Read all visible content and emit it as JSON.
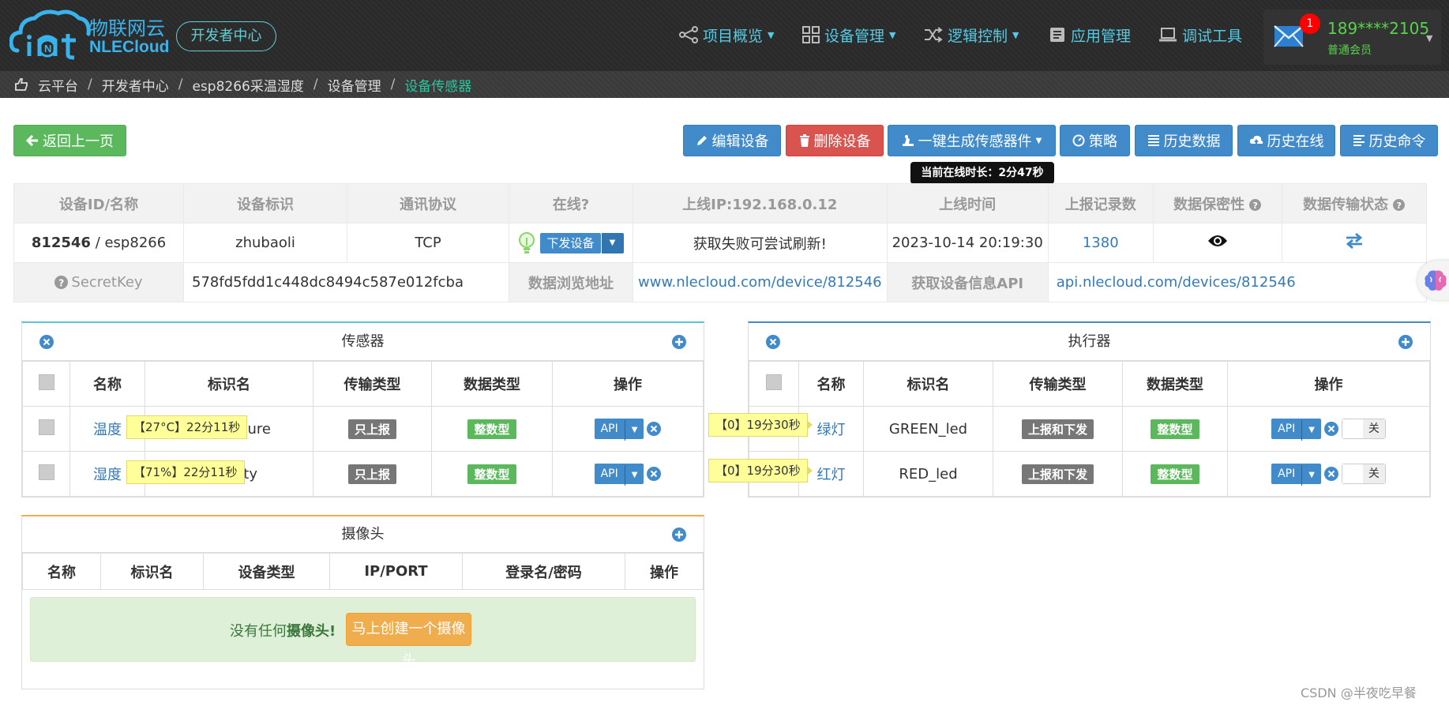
{
  "header": {
    "logo_cn": "物联网云",
    "logo_en": "NLECloud",
    "dev_center": "开发者中心",
    "nav": [
      {
        "label": "项目概览",
        "icon": "share-nodes-icon",
        "has_caret": true
      },
      {
        "label": "设备管理",
        "icon": "grid-icon",
        "has_caret": true
      },
      {
        "label": "逻辑控制",
        "icon": "shuffle-icon",
        "has_caret": true
      },
      {
        "label": "应用管理",
        "icon": "book-icon",
        "has_caret": false
      },
      {
        "label": "调试工具",
        "icon": "laptop-icon",
        "has_caret": false
      }
    ],
    "mail_badge": "1",
    "user_phone": "189****2105",
    "user_level": "普通会员"
  },
  "breadcrumb": {
    "items": [
      "云平台",
      "开发者中心",
      "esp8266采温湿度",
      "设备管理"
    ],
    "current": "设备传感器",
    "sep": "/"
  },
  "toolbar": {
    "back": "返回上一页",
    "edit": "编辑设备",
    "delete": "删除设备",
    "generate": "一键生成传感器件",
    "strategy": "策略",
    "history_data": "历史数据",
    "history_online": "历史在线",
    "history_cmd": "历史命令",
    "tooltip": "当前在线时长：2分47秒"
  },
  "device_info": {
    "headers": [
      "设备ID/名称",
      "设备标识",
      "通讯协议",
      "在线?",
      "上线IP:192.168.0.12",
      "上线时间",
      "上报记录数",
      "数据保密性",
      "数据传输状态"
    ],
    "id": "812546",
    "name_sep": " / ",
    "name": "esp8266",
    "tag": "zhubaoli",
    "protocol": "TCP",
    "send_btn": "下发设备",
    "ip_msg": "获取失败可尝试刷新!",
    "online_time": "2023-10-14 20:19:30",
    "record_count": "1380",
    "secret_label": "SecretKey",
    "secret_key": "578fd5fdd1c448dc8494c587e012fcba",
    "browse_label": "数据浏览地址",
    "browse_url": "www.nlecloud.com/device/812546",
    "api_label": "获取设备信息API",
    "api_url": "api.nlecloud.com/devices/812546"
  },
  "sensors": {
    "title": "传感器",
    "headers": [
      "名称",
      "标识名",
      "传输类型",
      "数据类型",
      "操作"
    ],
    "rows": [
      {
        "name": "温度",
        "id_tail": "ure",
        "tooltip": "【27°C】22分11秒",
        "trans": "只上报",
        "dtype": "整数型",
        "api": "API"
      },
      {
        "name": "湿度",
        "id_tail": "ty",
        "tooltip": "【71%】22分11秒",
        "trans": "只上报",
        "dtype": "整数型",
        "api": "API"
      }
    ]
  },
  "actuators": {
    "title": "执行器",
    "headers": [
      "名称",
      "标识名",
      "传输类型",
      "数据类型",
      "操作"
    ],
    "rows": [
      {
        "name": "绿灯",
        "ident": "GREEN_led",
        "tooltip": "【0】19分30秒",
        "trans": "上报和下发",
        "dtype": "整数型",
        "api": "API",
        "switch": "关"
      },
      {
        "name": "红灯",
        "ident": "RED_led",
        "tooltip": "【0】19分30秒",
        "trans": "上报和下发",
        "dtype": "整数型",
        "api": "API",
        "switch": "关"
      }
    ]
  },
  "cameras": {
    "title": "摄像头",
    "headers": [
      "名称",
      "标识名",
      "设备类型",
      "IP/PORT",
      "登录名/密码",
      "操作"
    ],
    "empty_prefix": "没有任何",
    "empty_bold": "摄像头!",
    "create_btn": "马上创建一个摄像头"
  },
  "watermark": "CSDN @半夜吃早餐",
  "colors": {
    "accent_blue": "#428bca",
    "danger": "#d9534f",
    "success": "#5cb85c",
    "warning": "#f0ad4e",
    "header_cyan": "#56c9e5",
    "user_green": "#5ad14d"
  }
}
